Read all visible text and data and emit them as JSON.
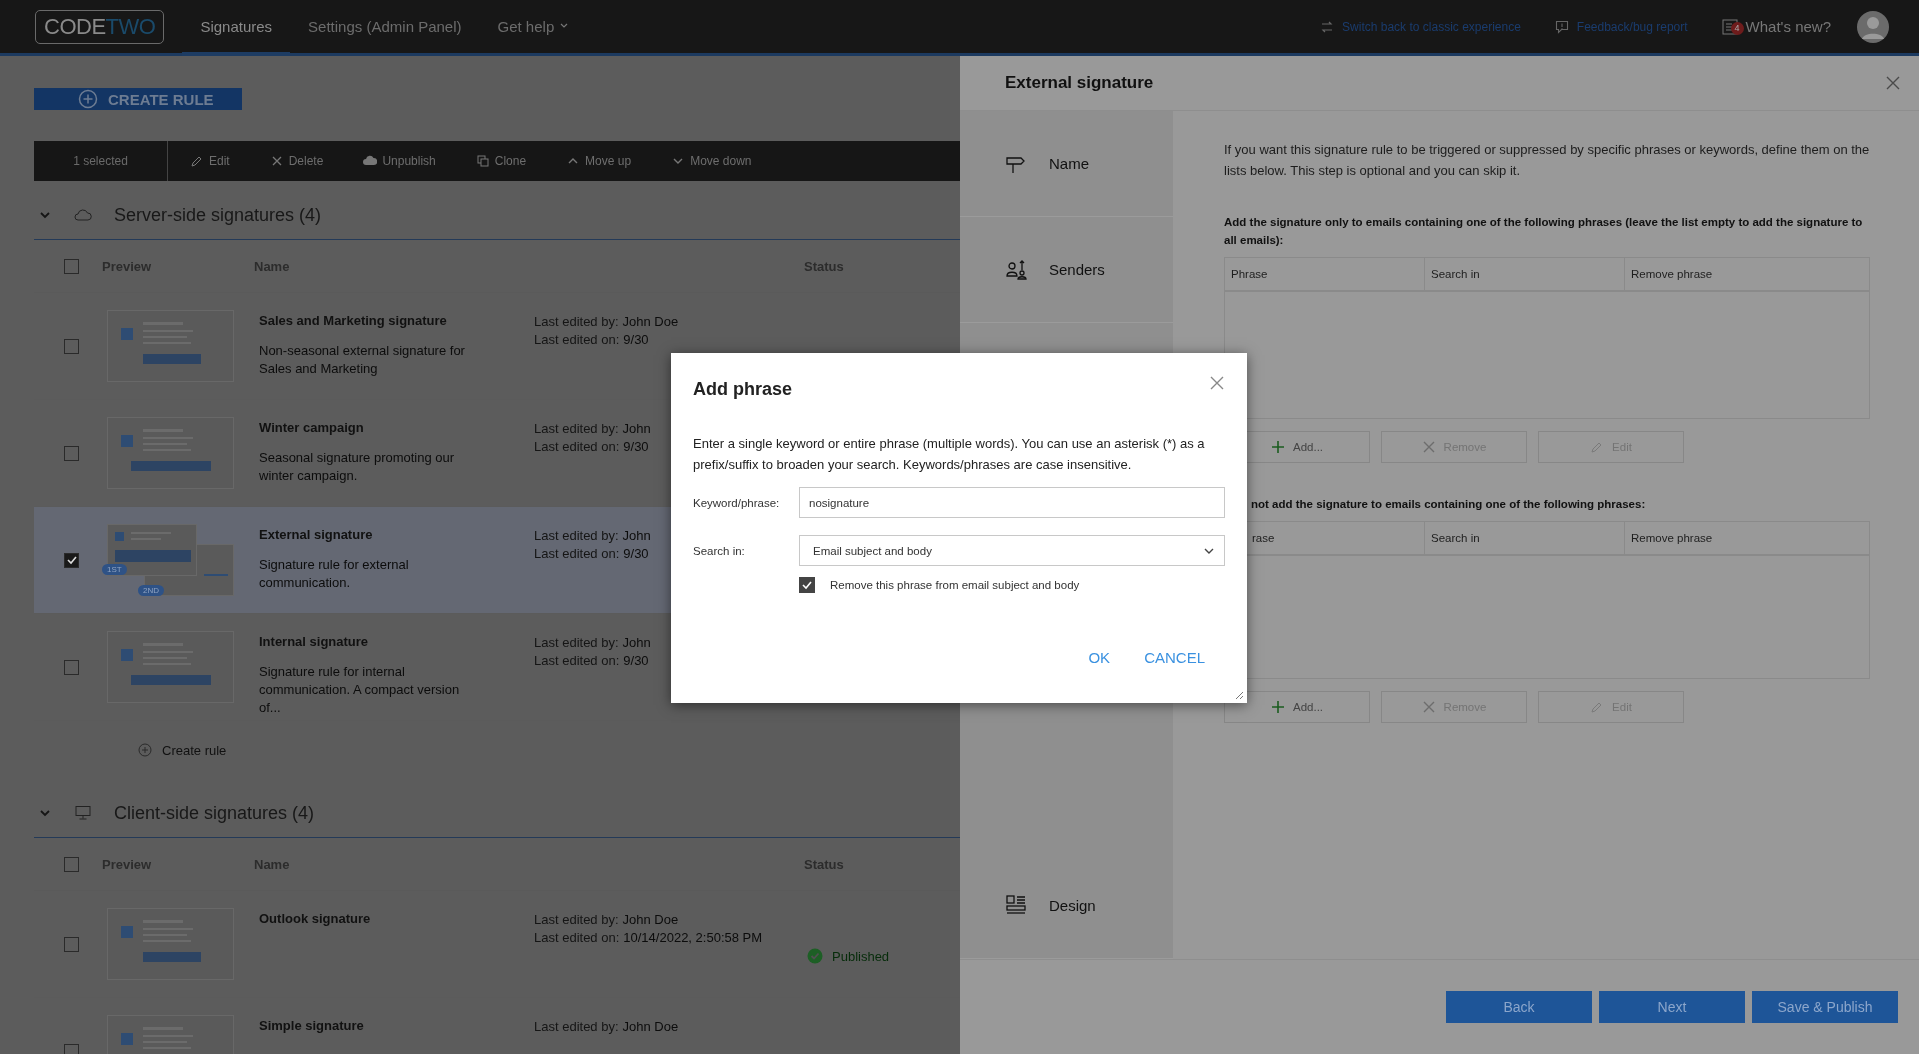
{
  "top_bar": {
    "logo": [
      "CODE",
      "TWO"
    ],
    "tabs": [
      {
        "label": "Signatures",
        "selected": true,
        "dropdown": false
      },
      {
        "label": "Settings (Admin Panel)",
        "selected": false,
        "dropdown": false
      },
      {
        "label": "Get help",
        "selected": false,
        "dropdown": true
      }
    ],
    "links": [
      {
        "label": "Switch back to classic experience",
        "kind": "switch"
      },
      {
        "label": "Feedback/bug report",
        "kind": "feedback"
      }
    ],
    "whats_new": {
      "label": "What's new?",
      "badge": "4"
    }
  },
  "create_rule_button": "CREATE RULE",
  "toolbar": {
    "selection": "1 selected",
    "actions": [
      {
        "label": "Edit",
        "kind": "edit"
      },
      {
        "label": "Delete",
        "kind": "delete"
      },
      {
        "label": "Unpublish",
        "kind": "unpublish"
      },
      {
        "label": "Clone",
        "kind": "clone"
      },
      {
        "label": "Move up",
        "kind": "up"
      },
      {
        "label": "Move down",
        "kind": "down"
      }
    ]
  },
  "sections": [
    {
      "title": "Server-side signatures (4)",
      "kind": "server",
      "expanded": true,
      "select_all_checked": false,
      "columns": [
        "Preview",
        "Name",
        "Status"
      ],
      "rows": [
        {
          "name": "Sales and Marketing signature",
          "description": "Non-seasonal external signature for Sales and Marketing",
          "edited_by_label": "Last edited by:",
          "edited_by": "John Doe",
          "edited_on_label": "Last edited on:",
          "edited_on": "9/30",
          "selected": false
        },
        {
          "name": "Winter campaign",
          "description": "Seasonal signature promoting our winter campaign.",
          "edited_by_label": "Last edited by:",
          "edited_by": "John",
          "edited_on_label": "Last edited on:",
          "edited_on": "9/30",
          "selected": false
        },
        {
          "name": "External signature",
          "description": "Signature rule for external communication.",
          "edited_by_label": "Last edited by:",
          "edited_by": "John",
          "edited_on_label": "Last edited on:",
          "edited_on": "9/30",
          "selected": true,
          "badges": [
            "1ST",
            "2ND"
          ]
        },
        {
          "name": "Internal signature",
          "description": "Signature rule for internal communication. A compact version of...",
          "edited_by_label": "Last edited by:",
          "edited_by": "John",
          "edited_on_label": "Last edited on:",
          "edited_on": "9/30",
          "selected": false
        }
      ],
      "create_rule": "Create rule"
    },
    {
      "title": "Client-side signatures (4)",
      "kind": "client",
      "expanded": true,
      "select_all_checked": false,
      "columns": [
        "Preview",
        "Name",
        "Status"
      ],
      "rows": [
        {
          "name": "Outlook signature",
          "edited_by_label": "Last edited by:",
          "edited_by": "John Doe",
          "edited_on_label": "Last edited on:",
          "edited_on": "10/14/2022, 2:50:58 PM",
          "selected": false,
          "status": {
            "label": "Published",
            "kind": "published"
          }
        },
        {
          "name": "Simple signature",
          "edited_by_label": "Last edited by:",
          "edited_by": "John Doe",
          "selected": false
        }
      ]
    }
  ],
  "panel": {
    "title": "External signature",
    "nav_top": [
      {
        "label": "Name",
        "kind": "name"
      },
      {
        "label": "Senders",
        "kind": "senders"
      }
    ],
    "nav_bottom": [
      {
        "label": "Design",
        "kind": "design"
      }
    ],
    "intro": "If you want this signature rule to be triggered or suppressed by specific phrases or keywords, define them on the lists below. This step is optional and you can skip it.",
    "lists": [
      {
        "label": "Add the signature only to emails containing one of the following phrases (leave the list empty to add the signature to all emails):",
        "columns": [
          "Phrase",
          "Search in",
          "Remove phrase"
        ],
        "buttons": [
          {
            "label": "Add...",
            "kind": "add",
            "disabled": false
          },
          {
            "label": "Remove",
            "kind": "remove",
            "disabled": true
          },
          {
            "label": "Edit",
            "kind": "edit",
            "disabled": true
          }
        ]
      },
      {
        "label": "not add the signature to emails containing one of the following phrases:",
        "columns": [
          "rase",
          "Search in",
          "Remove phrase"
        ],
        "buttons": [
          {
            "label": "Add...",
            "kind": "add",
            "disabled": false
          },
          {
            "label": "Remove",
            "kind": "remove",
            "disabled": true
          },
          {
            "label": "Edit",
            "kind": "edit",
            "disabled": true
          }
        ]
      }
    ],
    "footer_buttons": [
      "Back",
      "Next",
      "Save & Publish"
    ]
  },
  "dialog": {
    "title": "Add phrase",
    "description": "Enter a single keyword or entire phrase (multiple words). You can use an asterisk (*) as a prefix/suffix to broaden your search. Keywords/phrases are case insensitive.",
    "keyword": {
      "label": "Keyword/phrase:",
      "value": "nosignature"
    },
    "search_in": {
      "label": "Search in:",
      "value": "Email subject and body"
    },
    "remove": {
      "label": "Remove this phrase from email subject and body",
      "checked": true
    },
    "buttons": [
      "OK",
      "CANCEL"
    ]
  }
}
